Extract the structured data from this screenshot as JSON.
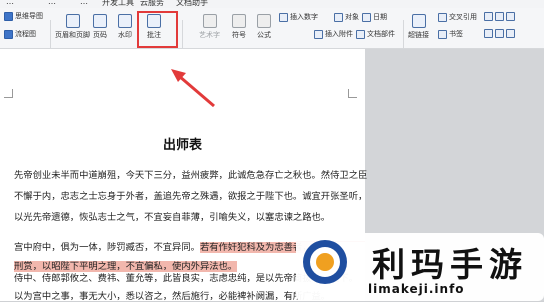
{
  "ribbon": {
    "tabs": [
      "…",
      "…",
      "…",
      "开发工具",
      "云服务",
      "文档助手"
    ]
  },
  "toolbar": {
    "mindmap": "思维导图",
    "flowchart": "流程图",
    "header_footer": "页眉和页脚",
    "page_number": "页码",
    "watermark": "水印",
    "comment": "批注",
    "art_text": "艺术字",
    "symbol": "符号",
    "formula": "公式",
    "insert_number": "插入数字",
    "insert_attachment": "插入附件",
    "object": "对象",
    "doc_parts": "文档部件",
    "date": "日期",
    "hyperlink": "超链接",
    "cross_reference": "交叉引用",
    "bookmark": "书签"
  },
  "document": {
    "title": "出师表",
    "lines": [
      "先帝创业未半而中道崩殂，今天下三分，益州疲弊，此诚危急存亡之秋也。然侍卫之臣",
      "不懈于内，忠志之士忘身于外者，盖追先帝之殊遇，欲报之于陛下也。诚宜开张圣听，",
      "以光先帝遗德，恢弘志士之气，不宜妄自菲薄，引喻失义，以塞忠谏之路也。",
      "宫中府中，俱为一体，陟罚臧否，不宜异同。",
      "若有作奸犯科及为忠善者，宜",
      "刑赏，以昭陛下平明之理，不宜偏私，使内外异法也。",
      "侍中、侍郎郭攸之、费祎、董允等，此皆良实，志虑忠纯，是以先帝简拔以遗陛下。",
      "以为宫中之事，事无大小，悉以咨之，然后施行，必能裨补阙漏，有所广益。"
    ]
  },
  "watermark": {
    "text": "利玛手游",
    "url": "limakeji.info"
  },
  "colors": {
    "highlight": "#f2b7ad",
    "callout": "#e23a3a",
    "logo_blue": "#1f4ea0",
    "logo_orange": "#f0a020"
  }
}
